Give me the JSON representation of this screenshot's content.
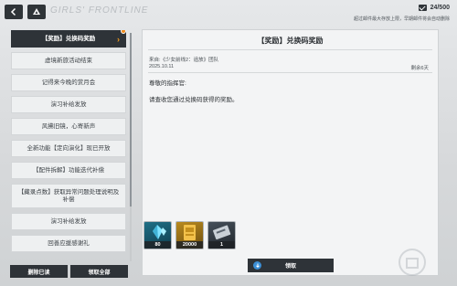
{
  "topbar": {
    "brand": "GIRLS' FRONTLINE",
    "capacity": "24/500",
    "notice": "超过邮件最大存放上限，早期邮件将会自动删除"
  },
  "list": {
    "items": [
      {
        "label": "【奖励】兑换码奖励",
        "active": true
      },
      {
        "label": "虚境新旅活动结束"
      },
      {
        "label": "记得来今晚的赏月会"
      },
      {
        "label": "演习补给发放"
      },
      {
        "label": "风拂旧镜，心寄新声"
      },
      {
        "label": "全新功能【定向演化】现已开放"
      },
      {
        "label": "【配件拆解】功能迭代补偿"
      },
      {
        "label": "【藏录点数】获取异常问题处理说明及补偿",
        "tall": true
      },
      {
        "label": "演习补给发放"
      },
      {
        "label": "回善应援感谢礼"
      }
    ]
  },
  "buttons": {
    "delete_read": "删除已读",
    "claim_all": "领取全部",
    "claim": "领取"
  },
  "mail": {
    "title": "【奖励】兑换码奖励",
    "sender": "来自:《少女前线2：追放》团队",
    "date": "2025.10.11",
    "remaining": "剩余6天",
    "greeting": "尊敬的指挥官:",
    "body": "请查收您通过兑换码获得的奖励。"
  },
  "rewards": [
    {
      "icon": "crystal-icon",
      "qty": "80"
    },
    {
      "icon": "credit-card-icon",
      "qty": "20000"
    },
    {
      "icon": "ticket-icon",
      "qty": "1"
    }
  ],
  "colors": {
    "accent": "#f29a1d",
    "dark": "#2e3338",
    "claim_icon": "#3c8fd6"
  }
}
